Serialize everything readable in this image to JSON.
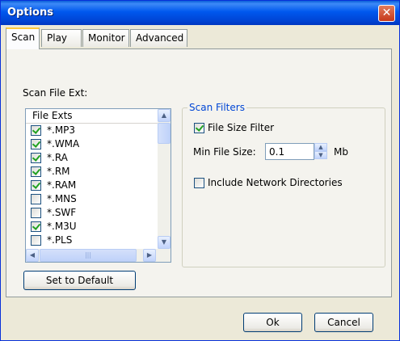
{
  "window": {
    "title": "Options",
    "close_glyph": "✕"
  },
  "tabs": [
    {
      "label": "Scan",
      "active": true
    },
    {
      "label": "Play"
    },
    {
      "label": "Monitor"
    },
    {
      "label": "Advanced"
    }
  ],
  "scan": {
    "ext_label": "Scan File Ext:",
    "list_header": "File Exts",
    "items": [
      {
        "label": "*.MP3",
        "checked": true
      },
      {
        "label": "*.WMA",
        "checked": true
      },
      {
        "label": "*.RA",
        "checked": true
      },
      {
        "label": "*.RM",
        "checked": true
      },
      {
        "label": "*.RAM",
        "checked": true
      },
      {
        "label": "*.MNS",
        "checked": false
      },
      {
        "label": "*.SWF",
        "checked": false
      },
      {
        "label": "*.M3U",
        "checked": true
      },
      {
        "label": "*.PLS",
        "checked": false
      }
    ],
    "default_button": "Set to Default"
  },
  "filters": {
    "group_title": "Scan Filters",
    "file_size_filter": {
      "label": "File Size Filter",
      "checked": true
    },
    "min_size_label": "Min File Size:",
    "min_size_value": "0.1",
    "min_size_unit": "Mb",
    "network": {
      "label": "Include Network Directories",
      "checked": false
    }
  },
  "footer": {
    "ok": "Ok",
    "cancel": "Cancel"
  }
}
